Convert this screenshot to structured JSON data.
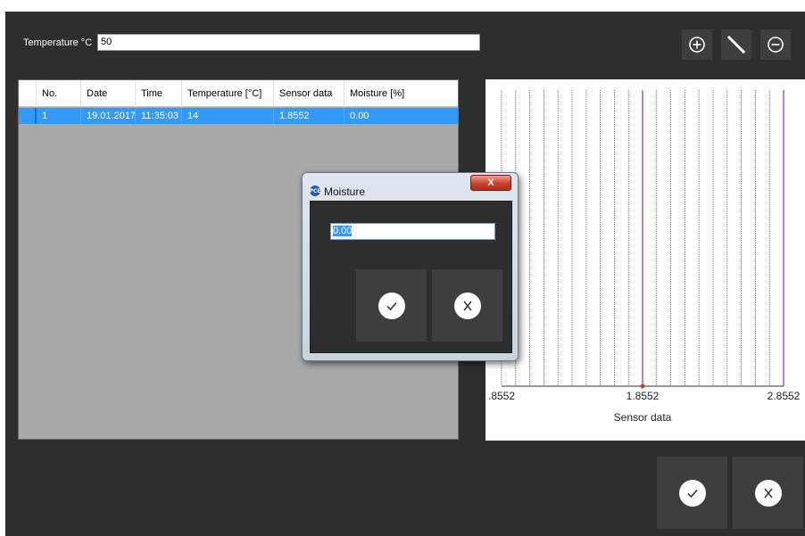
{
  "toolbar": {
    "temperature_label": "Temperature °C",
    "temperature_value": "50",
    "zoom_in_icon": "plus-circle",
    "line_icon": "diagonal-line",
    "zoom_out_icon": "minus-circle"
  },
  "table": {
    "columns": [
      {
        "label": "No."
      },
      {
        "label": "Date"
      },
      {
        "label": "Time"
      },
      {
        "label": "Temperature [°C]"
      },
      {
        "label": "Sensor data"
      },
      {
        "label": "Moisture [%]"
      }
    ],
    "rows": [
      {
        "no": "1",
        "date": "19.01.2017",
        "time": "11:35:03",
        "temperature": "14",
        "sensor": "1.8552",
        "moisture": "0.00"
      }
    ],
    "selection_color": "#3399ff"
  },
  "chart_data": {
    "type": "scatter",
    "xlabel": "Sensor data",
    "ylabel": "",
    "title": "",
    "xlim": [
      0.8552,
      2.8552
    ],
    "x_ticks": [
      ".8552",
      "1.8552",
      "2.8552"
    ],
    "points": [
      {
        "x": 1.8552,
        "y": 0
      }
    ],
    "highlight_lines_x": [
      1.8552,
      2.8552
    ],
    "gridlines_x_count": 21,
    "colors": {
      "point": "#c0392b",
      "highlight": "#6a3fb5",
      "grid": "#555555"
    }
  },
  "dialog": {
    "title": "Moisture",
    "logo_text": "PCE",
    "close_label": "X",
    "input_value": "0.00",
    "ok_icon": "check-circle",
    "cancel_icon": "x-circle"
  },
  "footer": {
    "ok_icon": "check-circle",
    "cancel_icon": "x-circle"
  }
}
